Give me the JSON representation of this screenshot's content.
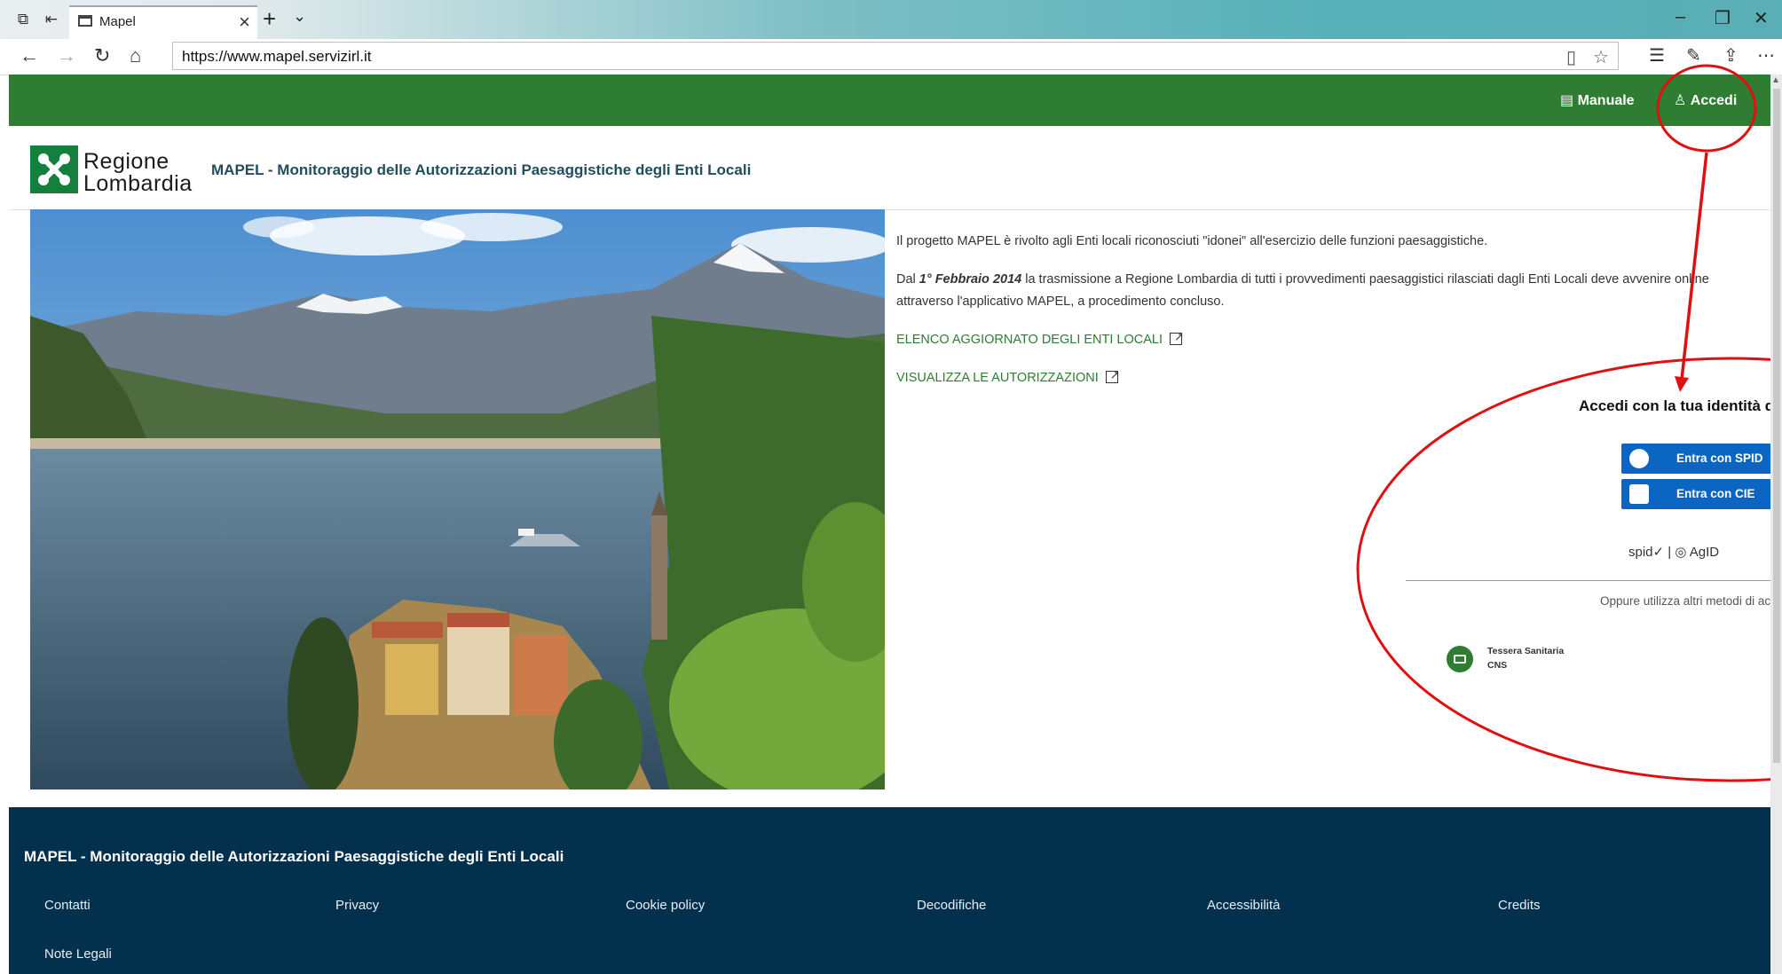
{
  "browser": {
    "tab_title": "Mapel",
    "url": "https://www.mapel.servizirl.it"
  },
  "topnav": {
    "manual_label": "Manuale",
    "login_label": "Accedi"
  },
  "header": {
    "logo_line1": "Regione",
    "logo_line2": "Lombardia",
    "site_title": "MAPEL - Monitoraggio delle Autorizzazioni Paesaggistiche degli Enti Locali"
  },
  "intro": {
    "p1": "Il progetto MAPEL è rivolto agli Enti locali riconosciuti \"idonei\" all'esercizio delle funzioni paesaggistiche.",
    "p2_prefix": "Dal",
    "p2_date": "1° Febbraio 2014",
    "p2_rest": "la trasmissione a Regione Lombardia di tutti i provvedimenti paesaggistici rilasciati dagli Enti Locali deve avvenire online attraverso l'applicativo MAPEL, a procedimento concluso.",
    "link_enti": "ELENCO AGGIORNATO DEGLI ENTI LOCALI",
    "link_autorizzazioni": "VISUALIZZA LE AUTORIZZAZIONI"
  },
  "login_panel": {
    "title": "Accedi con la tua identità dig",
    "spid_button": "Entra con SPID",
    "cie_button": "Entra con CIE",
    "logos": "spid✓  |  ◎ AgID",
    "alt_methods": "Oppure utilizza altri metodi di acces",
    "cns_line1": "Tessera Sanitaria",
    "cns_line2": "CNS"
  },
  "footer": {
    "title": "MAPEL - Monitoraggio delle Autorizzazioni Paesaggistiche degli Enti Locali",
    "links": [
      "Contatti",
      "Privacy",
      "Cookie policy",
      "Decodifiche",
      "Accessibilità",
      "Credits",
      "Note Legali"
    ]
  },
  "colors": {
    "topnav_green": "#2e7d32",
    "footer_navy": "#02304d",
    "id_button_blue": "#0b66c3",
    "annotation_red": "#e01010"
  }
}
